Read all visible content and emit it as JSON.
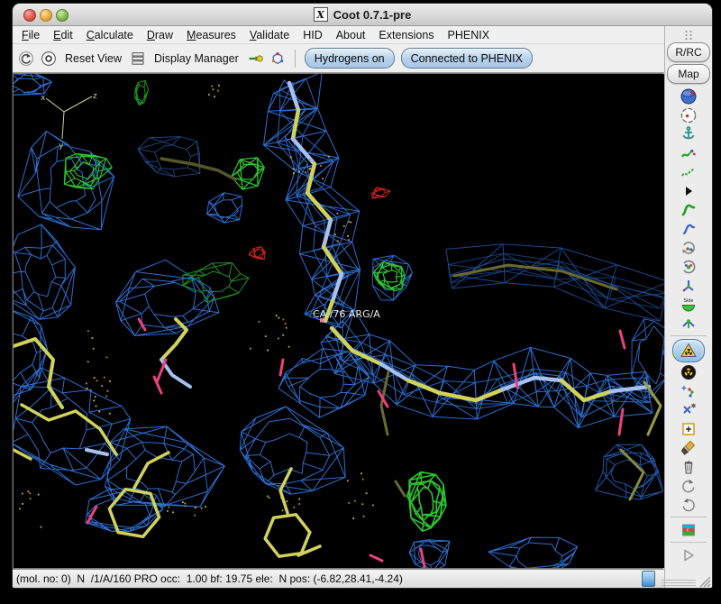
{
  "window": {
    "title": "Coot 0.7.1-pre",
    "title_icon": "x11-icon",
    "traffic_lights": [
      "close",
      "minimize",
      "zoom"
    ]
  },
  "menu_bar": {
    "items": [
      {
        "label": "File",
        "underline": 0
      },
      {
        "label": "Edit",
        "underline": 0
      },
      {
        "label": "Calculate",
        "underline": 0
      },
      {
        "label": "Draw",
        "underline": 0
      },
      {
        "label": "Measures",
        "underline": 0
      },
      {
        "label": "Validate",
        "underline": 0
      },
      {
        "label": "HID",
        "underline": -1
      },
      {
        "label": "About",
        "underline": -1
      },
      {
        "label": "Extensions",
        "underline": -1
      },
      {
        "label": "PHENIX",
        "underline": -1
      }
    ]
  },
  "toolbar": {
    "reset_view_label": "Reset View",
    "display_manager_label": "Display Manager",
    "icons": [
      "back-icon",
      "recentre-icon",
      "layers-icon",
      "key-ball-icon",
      "molecule-icon"
    ],
    "toggles": [
      {
        "label": "Hydrogens on",
        "state": "on"
      },
      {
        "label": "Connected to PHENIX",
        "state": "on"
      }
    ]
  },
  "right_panel": {
    "buttons": [
      {
        "label": "R/RC"
      },
      {
        "label": "Map"
      }
    ],
    "icons": [
      {
        "name": "globe-icon"
      },
      {
        "name": "recentre-view-icon"
      },
      {
        "name": "anchor-icon"
      },
      {
        "name": "refine-zone-icon"
      },
      {
        "name": "regularize-zone-icon"
      },
      {
        "name": "play-small-icon"
      },
      {
        "name": "mutate-icon"
      },
      {
        "name": "rotate-translate-icon"
      },
      {
        "name": "rotamer-cycle-icon"
      },
      {
        "name": "rotamer-fit-icon"
      },
      {
        "name": "pepflip-icon"
      },
      {
        "name": "side-chain-180-icon"
      },
      {
        "name": "jiggle-fit-icon"
      },
      {
        "separator": true
      },
      {
        "name": "radiation-triangle-icon",
        "selected": true
      },
      {
        "name": "radiation-round-icon"
      },
      {
        "name": "add-terminal-residue-icon"
      },
      {
        "name": "alt-conf-icon"
      },
      {
        "name": "add-atom-icon"
      },
      {
        "name": "brush-icon"
      },
      {
        "name": "delete-item-icon"
      },
      {
        "name": "undo-icon"
      },
      {
        "name": "redo-icon"
      },
      {
        "separator": true
      },
      {
        "name": "flag-icon"
      },
      {
        "separator": true
      },
      {
        "name": "run-script-icon"
      }
    ]
  },
  "canvas": {
    "atom_label": "CA /76 ARG/A",
    "axes_labels": {
      "x": "x",
      "y": "y",
      "z": "z"
    },
    "colors": {
      "background": "#000000",
      "density_blue": "#2e74dc",
      "density_blue_dim": "#1d54a6",
      "density_green": "#2ecc2e",
      "density_green_dim": "#1e9a1e",
      "density_red": "#cc2222",
      "carbon_yellow": "#d2d25a",
      "carbon_dark": "#6a6a30",
      "backbone_blue": "#a8c0f0",
      "oxygen_pink": "#ee3f7f",
      "water_dot": "#c8a030",
      "label_white": "#ececec",
      "axes": "#c8d49c"
    }
  },
  "status_bar": {
    "text": "(mol. no: 0)  N  /1/A/160 PRO occ:  1.00 bf: 19.75 ele:  N pos: (-6.82,28.41,-4.24)"
  }
}
